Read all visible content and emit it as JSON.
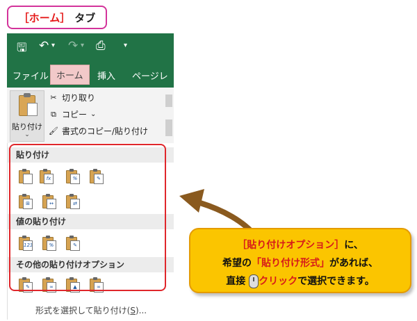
{
  "title_tag": {
    "bracket_text": "［ホーム］",
    "suffix": "タブ"
  },
  "qat": {
    "save_icon": "save-icon",
    "undo_icon": "undo-icon",
    "redo_icon": "redo-icon",
    "preview_icon": "print-preview-icon",
    "more_label": "▾"
  },
  "ribbon": {
    "tabs": [
      "ファイル",
      "ホーム",
      "挿入",
      "ページレ"
    ],
    "active_tab": "ホーム",
    "paste_label": "貼り付け",
    "paste_arrow": "⌄",
    "cut_label": "切り取り",
    "copy_label": "コピー",
    "copy_arrow": "⌄",
    "format_painter_label": "書式のコピー/貼り付け"
  },
  "paste_menu": {
    "section_paste": "貼り付け",
    "section_values": "値の貼り付け",
    "section_other": "その他の貼り付けオプション",
    "paste_options": [
      "paste",
      "formulas",
      "formulas-number-format",
      "keep-source-formatting",
      "no-borders",
      "keep-column-widths",
      "transpose"
    ],
    "value_options": [
      "values",
      "values-number-format",
      "values-source-formatting"
    ],
    "other_options": [
      "formatting",
      "paste-link",
      "picture",
      "linked-picture"
    ],
    "footer_text": "形式を選択して貼り付け(",
    "footer_key": "S",
    "footer_tail": ")..."
  },
  "callout": {
    "line1_highlight": "［貼り付けオプション］",
    "line1_tail": "に、",
    "line2_prefix": "希望の",
    "line2_highlight": "「貼り付け形式」",
    "line2_tail": "があれば、",
    "line3_prefix": "直接",
    "line3_highlight": "クリック",
    "line3_tail": "で選択できます。"
  },
  "colors": {
    "excel_green": "#217346",
    "accent_red": "#e0262b",
    "callout_yellow": "#fbc500",
    "tag_border": "#d3339a"
  }
}
